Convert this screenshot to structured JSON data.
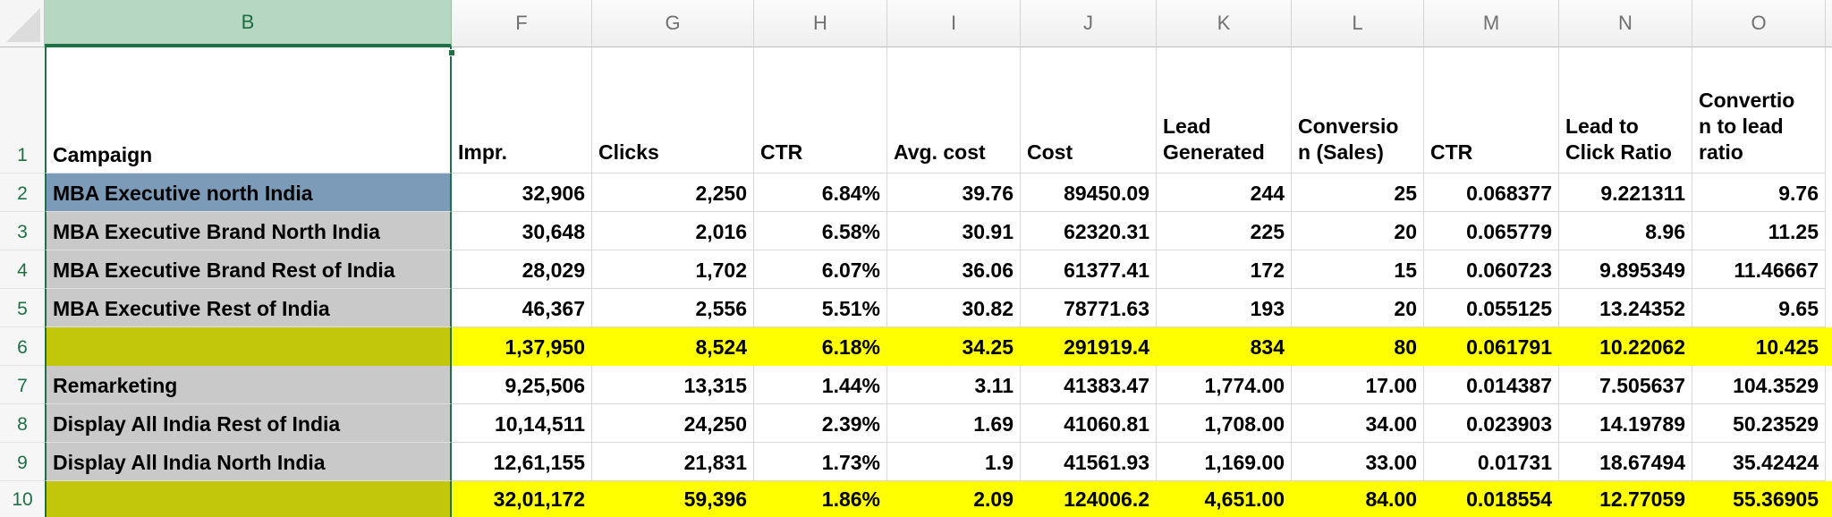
{
  "sheet": {
    "selected_column": "B",
    "column_letters": [
      "B",
      "F",
      "G",
      "H",
      "I",
      "J",
      "K",
      "L",
      "M",
      "N",
      "O"
    ],
    "header_row": {
      "row_number": "1",
      "campaign": "Campaign",
      "cols": [
        "Impr.",
        "Clicks",
        "CTR",
        "Avg. cost",
        "Cost",
        "Lead\nGenerated",
        "Conversio\nn (Sales)",
        "CTR",
        "Lead to\nClick Ratio",
        "Convertio\nn to lead\nratio"
      ]
    },
    "rows": [
      {
        "row": "2",
        "campaign": "MBA Executive north India",
        "style": "blue",
        "values": [
          "32,906",
          "2,250",
          "6.84%",
          "39.76",
          "89450.09",
          "244",
          "25",
          "0.068377",
          "9.221311",
          "9.76"
        ]
      },
      {
        "row": "3",
        "campaign": "MBA Executive Brand North India",
        "style": "gray",
        "values": [
          "30,648",
          "2,016",
          "6.58%",
          "30.91",
          "62320.31",
          "225",
          "20",
          "0.065779",
          "8.96",
          "11.25"
        ]
      },
      {
        "row": "4",
        "campaign": "MBA Executive Brand Rest of India",
        "style": "gray",
        "values": [
          "28,029",
          "1,702",
          "6.07%",
          "36.06",
          "61377.41",
          "172",
          "15",
          "0.060723",
          "9.895349",
          "11.46667"
        ]
      },
      {
        "row": "5",
        "campaign": "MBA Executive Rest of India",
        "style": "gray",
        "values": [
          "46,367",
          "2,556",
          "5.51%",
          "30.82",
          "78771.63",
          "193",
          "20",
          "0.055125",
          "13.24352",
          "9.65"
        ]
      },
      {
        "row": "6",
        "campaign": "",
        "style": "total",
        "values": [
          "1,37,950",
          "8,524",
          "6.18%",
          "34.25",
          "291919.4",
          "834",
          "80",
          "0.061791",
          "10.22062",
          "10.425"
        ]
      },
      {
        "row": "7",
        "campaign": "Remarketing",
        "style": "gray",
        "values": [
          "9,25,506",
          "13,315",
          "1.44%",
          "3.11",
          "41383.47",
          "1,774.00",
          "17.00",
          "0.014387",
          "7.505637",
          "104.3529"
        ]
      },
      {
        "row": "8",
        "campaign": "Display All India Rest of India",
        "style": "gray",
        "values": [
          "10,14,511",
          "24,250",
          "2.39%",
          "1.69",
          "41060.81",
          "1,708.00",
          "34.00",
          "0.023903",
          "14.19789",
          "50.23529"
        ]
      },
      {
        "row": "9",
        "campaign": "Display All India North India",
        "style": "gray",
        "values": [
          "12,61,155",
          "21,831",
          "1.73%",
          "1.9",
          "41561.93",
          "1,169.00",
          "33.00",
          "0.01731",
          "18.67494",
          "35.42424"
        ]
      },
      {
        "row": "10",
        "campaign": "",
        "style": "total",
        "values": [
          "32,01,172",
          "59,396",
          "1.86%",
          "2.09",
          "124006.2",
          "4,651.00",
          "84.00",
          "0.018554",
          "12.77059",
          "55.36905"
        ]
      }
    ],
    "colors": {
      "selection_green": "#1f7145",
      "selected_header_fill": "#b6d8c2",
      "row2_fill": "#7c9bb9",
      "campaign_fill": "#c9c9c9",
      "total_label_fill": "#c2c70c",
      "total_value_fill": "#ffff00"
    }
  }
}
